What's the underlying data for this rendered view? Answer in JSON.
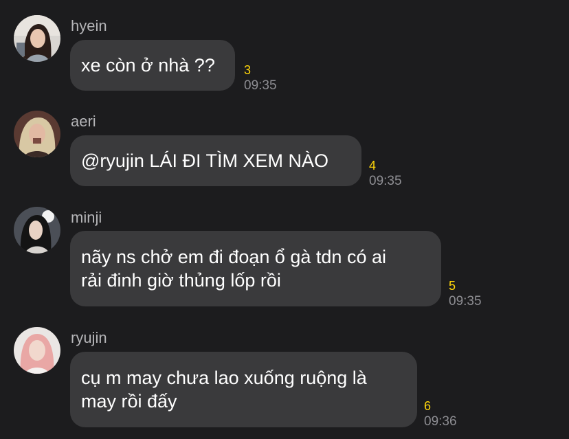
{
  "messages": [
    {
      "sender": "hyein",
      "avatar_icon": "user-avatar-icon",
      "lines": [
        "xe còn ở nhà ??"
      ],
      "count": "3",
      "time": "09:35"
    },
    {
      "sender": "aeri",
      "avatar_icon": "user-avatar-icon",
      "lines": [
        "@ryujin LÁI ĐI TÌM XEM NÀO"
      ],
      "count": "4",
      "time": "09:35"
    },
    {
      "sender": "minji",
      "avatar_icon": "user-avatar-icon",
      "lines": [
        "nãy ns chở em đi đoạn ổ gà tdn có ai",
        "rải đinh giờ thủng lốp rồi"
      ],
      "count": "5",
      "time": "09:35"
    },
    {
      "sender": "ryujin",
      "avatar_icon": "user-avatar-icon",
      "lines": [
        "cụ m may chưa lao xuống ruộng là",
        "may rồi đấy"
      ],
      "count": "6",
      "time": "09:36"
    }
  ],
  "colors": {
    "background": "#1c1c1e",
    "bubble": "#3a3a3c",
    "count": "#ffd60a",
    "time": "#8e8e93",
    "name": "#b5b5b8"
  }
}
